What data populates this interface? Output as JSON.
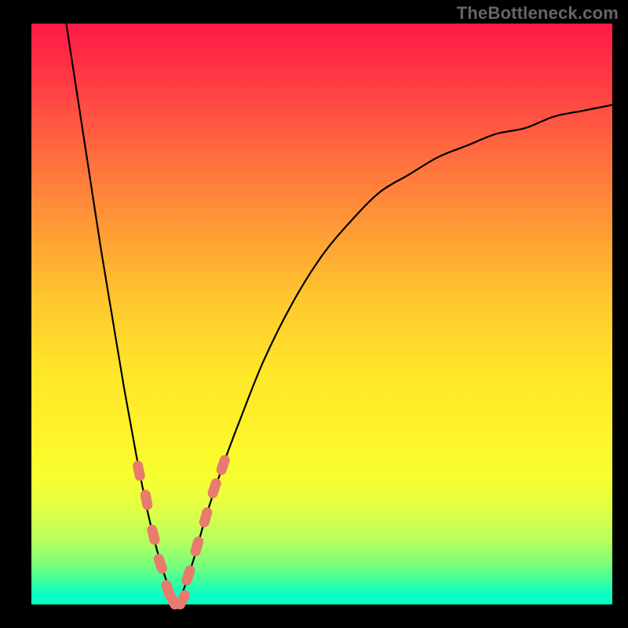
{
  "watermark": {
    "text": "TheBottleneck.com"
  },
  "chart_data": {
    "type": "line",
    "title": "",
    "xlabel": "",
    "ylabel": "",
    "xlim": [
      0,
      100
    ],
    "ylim": [
      0,
      100
    ],
    "grid": false,
    "series": [
      {
        "name": "bottleneck-curve",
        "x": [
          6,
          8,
          10,
          12,
          14,
          16,
          18,
          20,
          22,
          24,
          25,
          26,
          28,
          30,
          33,
          36,
          40,
          45,
          50,
          55,
          60,
          65,
          70,
          75,
          80,
          85,
          90,
          95,
          100
        ],
        "y": [
          100,
          87,
          74,
          61,
          49,
          37,
          26,
          16,
          8,
          2,
          0,
          2,
          8,
          15,
          24,
          32,
          42,
          52,
          60,
          66,
          71,
          74,
          77,
          79,
          81,
          82,
          84,
          85,
          86
        ],
        "color": "#000000"
      }
    ],
    "markers": [
      {
        "name": "pill-markers-left",
        "color": "#e87a6e",
        "points": [
          {
            "x": 18.5,
            "y": 23
          },
          {
            "x": 19.8,
            "y": 18
          },
          {
            "x": 21.0,
            "y": 12
          },
          {
            "x": 22.2,
            "y": 7
          },
          {
            "x": 23.5,
            "y": 2.5
          }
        ]
      },
      {
        "name": "pill-markers-right",
        "color": "#e87a6e",
        "points": [
          {
            "x": 27.0,
            "y": 5
          },
          {
            "x": 28.5,
            "y": 10
          },
          {
            "x": 30.0,
            "y": 15
          },
          {
            "x": 31.5,
            "y": 20
          },
          {
            "x": 33.0,
            "y": 24
          }
        ]
      },
      {
        "name": "pill-markers-bottom",
        "color": "#e87a6e",
        "points": [
          {
            "x": 24.3,
            "y": 0.8
          },
          {
            "x": 26.0,
            "y": 0.8
          }
        ]
      }
    ]
  }
}
